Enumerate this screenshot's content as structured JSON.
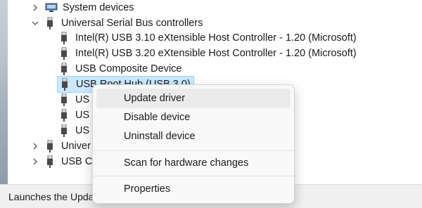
{
  "tree": {
    "system_devices": "System devices",
    "usb_controllers": "Universal Serial Bus controllers",
    "children": [
      "Intel(R) USB 3.10 eXtensible Host Controller - 1.20 (Microsoft)",
      "Intel(R) USB 3.20 eXtensible Host Controller - 1.20 (Microsoft)",
      "USB Composite Device",
      "USB Root Hub (USB 3.0)",
      "US",
      "US",
      "US"
    ],
    "bottom_rows": [
      "Univer",
      "USB Co"
    ]
  },
  "context_menu": {
    "update": "Update driver",
    "disable": "Disable device",
    "uninstall": "Uninstall device",
    "scan": "Scan for hardware changes",
    "properties": "Properties"
  },
  "status_bar": {
    "text": "Launches the Upda"
  },
  "colors": {
    "selection_bg": "#cce8ff",
    "selection_border": "#99d1ff",
    "menu_bg": "#f9f9f9",
    "menu_hover": "#ebebeb"
  },
  "icons": {
    "expand": "chevron-right-icon",
    "collapse": "chevron-down-icon",
    "usb": "usb-plug-icon",
    "system": "system-devices-icon"
  }
}
